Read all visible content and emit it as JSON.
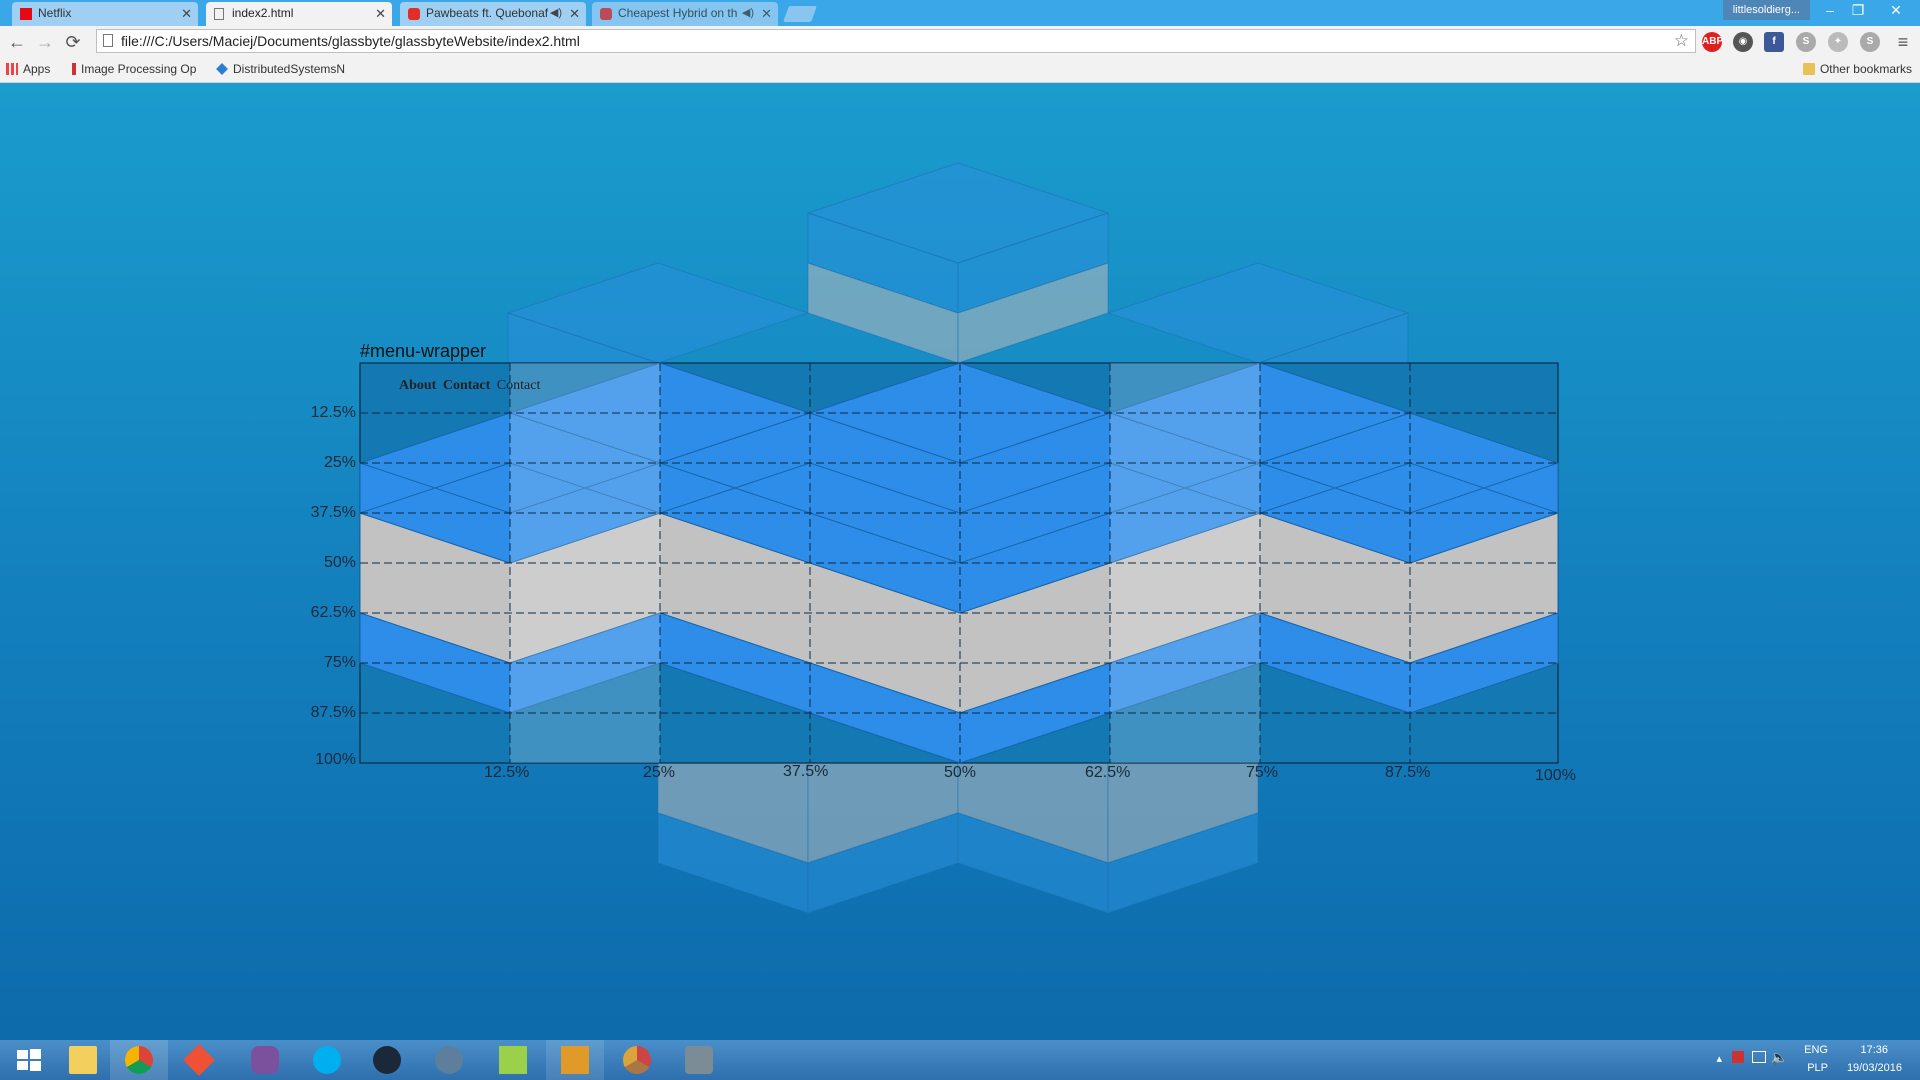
{
  "browser": {
    "tabs": [
      {
        "title": "Netflix",
        "icon": "netflix-icon",
        "active": false
      },
      {
        "title": "index2.html",
        "icon": "page-icon",
        "active": true
      },
      {
        "title": "Pawbeats ft. Quebonaf",
        "icon": "youtube-icon",
        "active": false
      },
      {
        "title": "Cheapest Hybrid on th",
        "icon": "youtube-icon",
        "active": false
      }
    ],
    "profile_name": "littlesoldierg...",
    "url": "file:///C:/Users/Maciej/Documents/glassbyte/glassbyteWebsite/index2.html",
    "bookmarks": [
      {
        "label": "Apps",
        "icon": "apps-grid-icon"
      },
      {
        "label": "Image Processing Op",
        "icon": "bookmark-page-icon"
      },
      {
        "label": "DistributedSystemsN",
        "icon": "dropbox-icon"
      }
    ],
    "other_bookmarks": "Other bookmarks",
    "extensions": [
      "adblock-icon",
      "extension-icon",
      "facebook-icon",
      "skype-icon",
      "extension-icon",
      "skype-icon"
    ]
  },
  "page": {
    "wrapper_label": "#menu-wrapper",
    "menu_links": [
      "About",
      "Contact",
      "Contact"
    ],
    "y_labels": [
      "12.5%",
      "25%",
      "37.5%",
      "50%",
      "62.5%",
      "75%",
      "87.5%",
      "100%"
    ],
    "x_labels": [
      "12.5%",
      "25%",
      "37.5%",
      "50%",
      "62.5%",
      "75%",
      "87.5%",
      "100%"
    ],
    "colors": {
      "background_top": "#1a9ccd",
      "background_bottom": "#0d6aab",
      "blue_face": "#2e8de8",
      "grey_face": "#c2c2c2",
      "teal_face": "#1381b7"
    }
  },
  "taskbar": {
    "apps": [
      "windows-start-icon",
      "file-explorer-icon",
      "chrome-icon",
      "git-icon",
      "viber-icon",
      "skype-icon",
      "steam-icon",
      "teamspeak-icon",
      "notepad-icon",
      "csgo-icon",
      "chrome-canary-icon",
      "game-app-icon"
    ],
    "tray": {
      "lang_top": "ENG",
      "lang_bottom": "PLP",
      "time": "17:36",
      "date": "19/03/2016"
    }
  }
}
